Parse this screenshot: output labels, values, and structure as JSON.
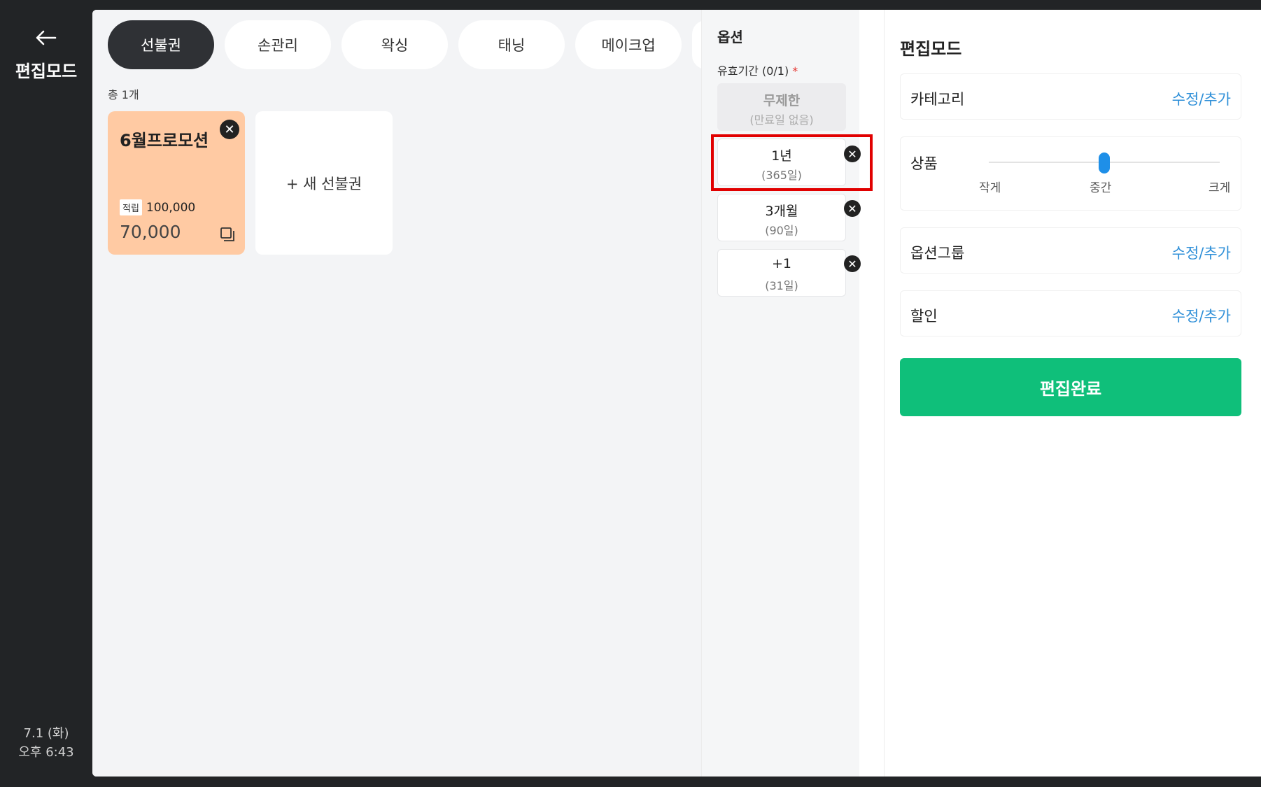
{
  "sidebar": {
    "back_icon": "arrow-left-icon",
    "title": "편집모드",
    "date": "7.1 (화)",
    "time": "오후 6:43"
  },
  "tabs": [
    {
      "label": "선불권",
      "active": true
    },
    {
      "label": "손관리",
      "active": false
    },
    {
      "label": "왁싱",
      "active": false
    },
    {
      "label": "태닝",
      "active": false
    },
    {
      "label": "메이크업",
      "active": false
    }
  ],
  "list": {
    "total": "총 1개",
    "cards": [
      {
        "name": "6월프로모션",
        "accum_badge": "적립",
        "accum_value": "100,000",
        "price": "70,000",
        "color": "#ffcaa3"
      }
    ],
    "new_card_label": "+ 새 선불권"
  },
  "options": {
    "title": "옵션",
    "validity_label": "유효기간 (0/1)",
    "required_mark": "*",
    "items": [
      {
        "main": "무제한",
        "sub": "(만료일 없음)",
        "disabled": true
      },
      {
        "main": "1년",
        "sub": "(365일)",
        "disabled": false
      },
      {
        "main": "3개월",
        "sub": "(90일)",
        "disabled": false
      },
      {
        "main": "+1",
        "sub": "(31일)",
        "disabled": false
      }
    ]
  },
  "edit": {
    "title": "편집모드",
    "category_label": "카테고리",
    "category_action": "수정/추가",
    "product_label": "상품",
    "product_size_level": 0.5,
    "size_small": "작게",
    "size_medium": "중간",
    "size_large": "크게",
    "option_group_label": "옵션그룹",
    "option_group_action": "수정/추가",
    "discount_label": "할인",
    "discount_action": "수정/추가",
    "done_label": "편집완료",
    "accent_color": "#0fbf7a",
    "link_color": "#2e8fd8"
  }
}
